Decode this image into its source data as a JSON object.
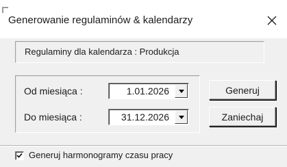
{
  "window": {
    "title": "Generowanie regulaminów & kalendarzy",
    "close_icon": "close-icon"
  },
  "info": {
    "text": "Regulaminy dla kalendarza :  Produkcja"
  },
  "dates": {
    "from_label": "Od miesiąca :",
    "from_value": "1.01.2026",
    "to_label": "Do miesiąca :",
    "to_value": "31.12.2026"
  },
  "buttons": {
    "generate_label": "Generuj",
    "cancel_label": "Zaniechaj"
  },
  "options": {
    "schedule_label": "Generuj harmonogramy czasu pracy",
    "schedule_checked": true
  },
  "colors": {
    "dialog_background": "#f0f0f0",
    "titlebar_background": "#ffffff"
  }
}
